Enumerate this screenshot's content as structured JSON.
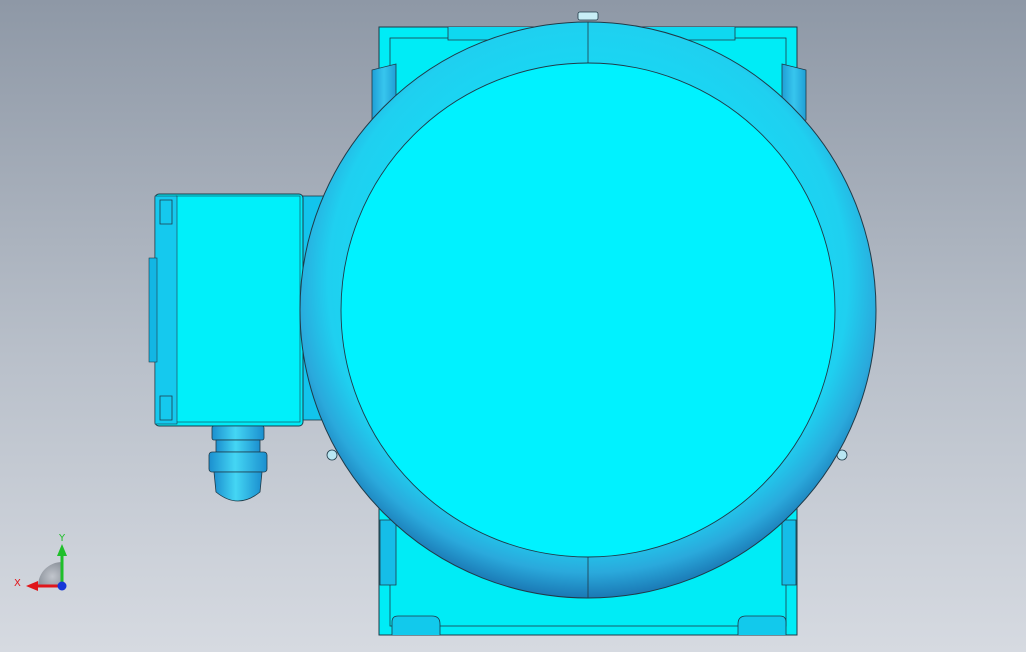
{
  "viewport": {
    "background_top": "#8e98a6",
    "background_bottom": "#d6dae1"
  },
  "model": {
    "description_icon": "motor-model",
    "body_color": "#00e6f2",
    "shade_color": "#1aa5d8",
    "edge_color": "#1f3a48"
  },
  "triad": {
    "x_label": "X",
    "y_label": "Y",
    "x_color": "#e0161b",
    "y_color": "#1fbf2a",
    "z_color": "#1636d8"
  }
}
